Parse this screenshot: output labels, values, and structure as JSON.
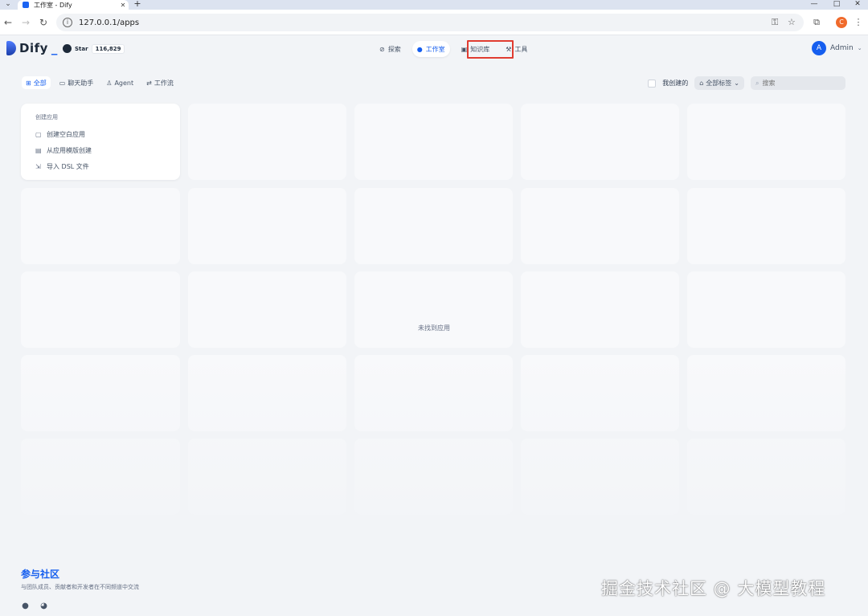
{
  "browser": {
    "tab_title": "工作室 - Dify",
    "url": "127.0.0.1/apps",
    "profile_initial": "C"
  },
  "header": {
    "logo": "Dify",
    "github": {
      "label": "Star",
      "count": "116,829"
    },
    "nav": [
      {
        "label": "探索",
        "icon": "compass-icon"
      },
      {
        "label": "工作室",
        "icon": "robot-icon",
        "active": true
      },
      {
        "label": "知识库",
        "icon": "book-icon",
        "highlighted": true
      },
      {
        "label": "工具",
        "icon": "hammer-icon"
      }
    ],
    "user": {
      "initial": "A",
      "name": "Admin"
    }
  },
  "filters": {
    "tabs": [
      {
        "label": "全部",
        "icon": "grid-icon",
        "active": true
      },
      {
        "label": "聊天助手",
        "icon": "chat-icon"
      },
      {
        "label": "Agent",
        "icon": "agent-icon"
      },
      {
        "label": "工作流",
        "icon": "workflow-icon"
      }
    ],
    "mine_label": "我创建的",
    "tag_select": "全部标签",
    "search_placeholder": "搜索"
  },
  "create_card": {
    "title": "创建应用",
    "items": [
      {
        "label": "创建空白应用",
        "icon": "file-plus-icon"
      },
      {
        "label": "从应用模版创建",
        "icon": "template-icon"
      },
      {
        "label": "导入 DSL 文件",
        "icon": "import-icon"
      }
    ]
  },
  "empty_message": "未找到应用",
  "community": {
    "title": "参与社区",
    "description": "与团队成员、贡献者和开发者在不同频道中交流"
  },
  "watermark": "掘金技术社区 @ 大模型教程",
  "colors": {
    "accent": "#155eef",
    "highlight": "#e03c31",
    "background": "#f2f4f7"
  }
}
